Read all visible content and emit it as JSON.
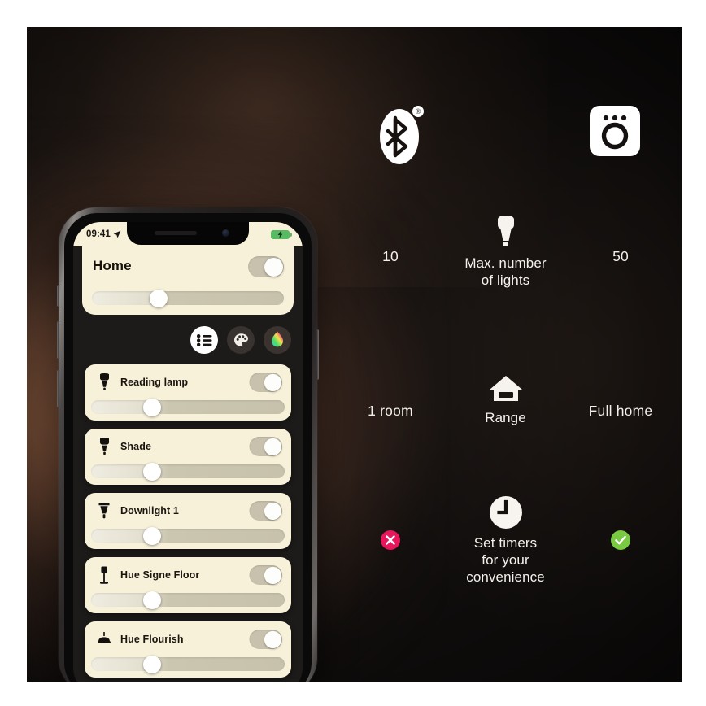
{
  "scene": {
    "background_dark": "#141110",
    "glow_warm": "#be7e58"
  },
  "header_icons": [
    {
      "name": "bluetooth-logo",
      "registered_mark": "®"
    },
    {
      "name": "philips-hue-logo"
    }
  ],
  "comparison": {
    "rows": [
      {
        "icon": "bulb-icon",
        "label": "Max. number\nof lights",
        "label_line1": "Max. number",
        "label_line2": "of lights",
        "left": "10",
        "right": "50",
        "left_type": "text",
        "right_type": "text"
      },
      {
        "icon": "house-range-icon",
        "label_line1": "Range",
        "label_line2": "",
        "left": "1 room",
        "right": "Full home",
        "left_type": "text",
        "right_type": "text"
      },
      {
        "icon": "clock-timer-icon",
        "label_line1": "Set timers",
        "label_line2": "for your",
        "label_line3": "convenience",
        "left": "",
        "right": "",
        "left_type": "cross",
        "right_type": "check",
        "cross_color": "#e6175c",
        "check_color": "#7ac943"
      }
    ]
  },
  "phone": {
    "status_bar": {
      "time": "09:41",
      "location_icon": "location-arrow-icon",
      "battery_icon": "battery-charging-icon",
      "battery_color": "#57bb63"
    },
    "home": {
      "title": "Home",
      "master_toggle": "on",
      "master_brightness_percent": 36
    },
    "tabs": [
      {
        "name": "tab-rooms-list",
        "icon": "list-icon",
        "state": "active"
      },
      {
        "name": "tab-scenes",
        "icon": "palette-icon",
        "state": "inactive"
      },
      {
        "name": "tab-color",
        "icon": "color-droplet-icon",
        "state": "inactive"
      }
    ],
    "lights": [
      {
        "name": "Reading lamp",
        "icon": "bulb-icon",
        "toggle": "on",
        "brightness_percent": 33
      },
      {
        "name": "Shade",
        "icon": "bulb-icon",
        "toggle": "on",
        "brightness_percent": 33
      },
      {
        "name": "Downlight 1",
        "icon": "downlight-icon",
        "toggle": "on",
        "brightness_percent": 33
      },
      {
        "name": "Hue Signe Floor",
        "icon": "floor-lamp-icon",
        "toggle": "on",
        "brightness_percent": 33
      },
      {
        "name": "Hue Flourish",
        "icon": "pendant-lamp-icon",
        "toggle": "on",
        "brightness_percent": 33
      }
    ]
  }
}
